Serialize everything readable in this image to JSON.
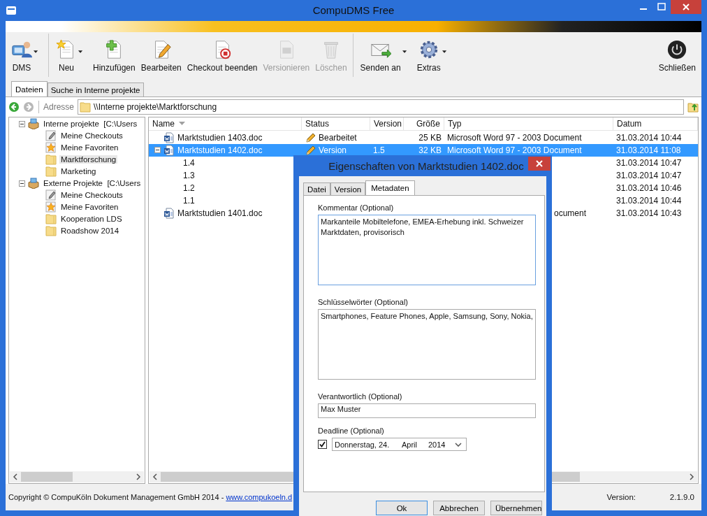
{
  "window": {
    "title": "CompuDMS Free"
  },
  "toolbar": [
    {
      "label": "DMS",
      "disabled": false,
      "dropdown": true,
      "separator_after": true
    },
    {
      "label": "Neu",
      "disabled": false,
      "dropdown": true,
      "separator_after": false
    },
    {
      "label": "Hinzufügen",
      "disabled": false,
      "dropdown": false,
      "separator_after": false
    },
    {
      "label": "Bearbeiten",
      "disabled": false,
      "dropdown": false,
      "separator_after": false
    },
    {
      "label": "Checkout beenden",
      "disabled": false,
      "dropdown": false,
      "separator_after": false
    },
    {
      "label": "Versionieren",
      "disabled": true,
      "dropdown": false,
      "separator_after": false
    },
    {
      "label": "Löschen",
      "disabled": true,
      "dropdown": false,
      "separator_after": true
    },
    {
      "label": "Senden an",
      "disabled": false,
      "dropdown": true,
      "separator_after": false
    },
    {
      "label": "Extras",
      "disabled": false,
      "dropdown": true,
      "separator_after": false
    }
  ],
  "close_button": {
    "label": "Schließen"
  },
  "tabs": [
    {
      "label": "Dateien",
      "selected": true
    },
    {
      "label": "Suche in Interne projekte",
      "selected": false
    }
  ],
  "address": {
    "label": "Adresse",
    "value": "\\\\Interne projekte\\Marktforschung"
  },
  "tree": [
    {
      "label": "Interne projekte  [C:\\Users",
      "expanded": true,
      "children": [
        {
          "label": "Meine Checkouts",
          "kind": "checkouts",
          "selected": false
        },
        {
          "label": "Meine Favoriten",
          "kind": "favorites",
          "selected": false
        },
        {
          "label": "Marktforschung",
          "kind": "folder",
          "selected": true
        },
        {
          "label": "Marketing",
          "kind": "folder",
          "selected": false
        }
      ]
    },
    {
      "label": "Externe Projekte  [C:\\Users",
      "expanded": true,
      "children": [
        {
          "label": "Meine Checkouts",
          "kind": "checkouts",
          "selected": false
        },
        {
          "label": "Meine Favoriten",
          "kind": "favorites",
          "selected": false
        },
        {
          "label": "Kooperation LDS",
          "kind": "folder",
          "selected": false
        },
        {
          "label": "Roadshow 2014",
          "kind": "folder",
          "selected": false
        }
      ]
    }
  ],
  "table": {
    "columns": [
      "Name",
      "Status",
      "Version",
      "Größe",
      "Typ",
      "Datum"
    ],
    "rows": [
      {
        "name": "Marktstudien 1403.doc",
        "status": "Bearbeitet",
        "version": "",
        "size": "25 KB",
        "type": "Microsoft Word 97 - 2003 Document",
        "type_clipped": false,
        "date": "31.03.2014 10:44",
        "selected": false
      },
      {
        "name": "Marktstudien 1402.doc",
        "status": "Version",
        "version": "1.5",
        "size": "32 KB",
        "type": "Microsoft Word 97 - 2003 Document",
        "type_clipped": false,
        "date": "31.03.2014 11:08",
        "selected": true,
        "expanded": true,
        "children": [
          {
            "name": "1.4",
            "date": "31.03.2014 10:47"
          },
          {
            "name": "1.3",
            "date": "31.03.2014 10:47"
          },
          {
            "name": "1.2",
            "date": "31.03.2014 10:46"
          },
          {
            "name": "1.1",
            "date": "31.03.2014 10:44"
          }
        ]
      },
      {
        "name": "Marktstudien 1401.doc",
        "status": "",
        "version": "",
        "size": "",
        "type": "ocument",
        "type_clipped": true,
        "date": "31.03.2014 10:43",
        "selected": false
      }
    ]
  },
  "status_bar": {
    "copyright": "Copyright © CompuKöln Dokument Management GmbH 2014 - ",
    "link": "www.compukoeln.d",
    "version_label": "Version:",
    "version": "2.1.9.0"
  },
  "dialog": {
    "title": "Eigenschaften von Marktstudien 1402.doc",
    "tabs": [
      {
        "label": "Datei",
        "selected": false
      },
      {
        "label": "Version",
        "selected": false
      },
      {
        "label": "Metadaten",
        "selected": true
      }
    ],
    "comment": {
      "label": "Kommentar (Optional)",
      "value": "Markanteile Mobiltelefone, EMEA-Erhebung inkl. Schweizer Marktdaten, provisorisch"
    },
    "keywords": {
      "label": "Schlüsselwörter (Optional)",
      "value": "Smartphones, Feature Phones, Apple, Samsung, Sony, Nokia,"
    },
    "responsible": {
      "label": "Verantwortlich (Optional)",
      "value": "Max Muster"
    },
    "deadline": {
      "label": "Deadline (Optional)",
      "checked": true,
      "weekday_day": "Donnerstag, 24.",
      "month": "April",
      "year": "2014"
    },
    "buttons": [
      {
        "label": "Ok",
        "default": true
      },
      {
        "label": "Abbrechen",
        "default": false
      },
      {
        "label": "Übernehmen",
        "default": false
      }
    ]
  }
}
